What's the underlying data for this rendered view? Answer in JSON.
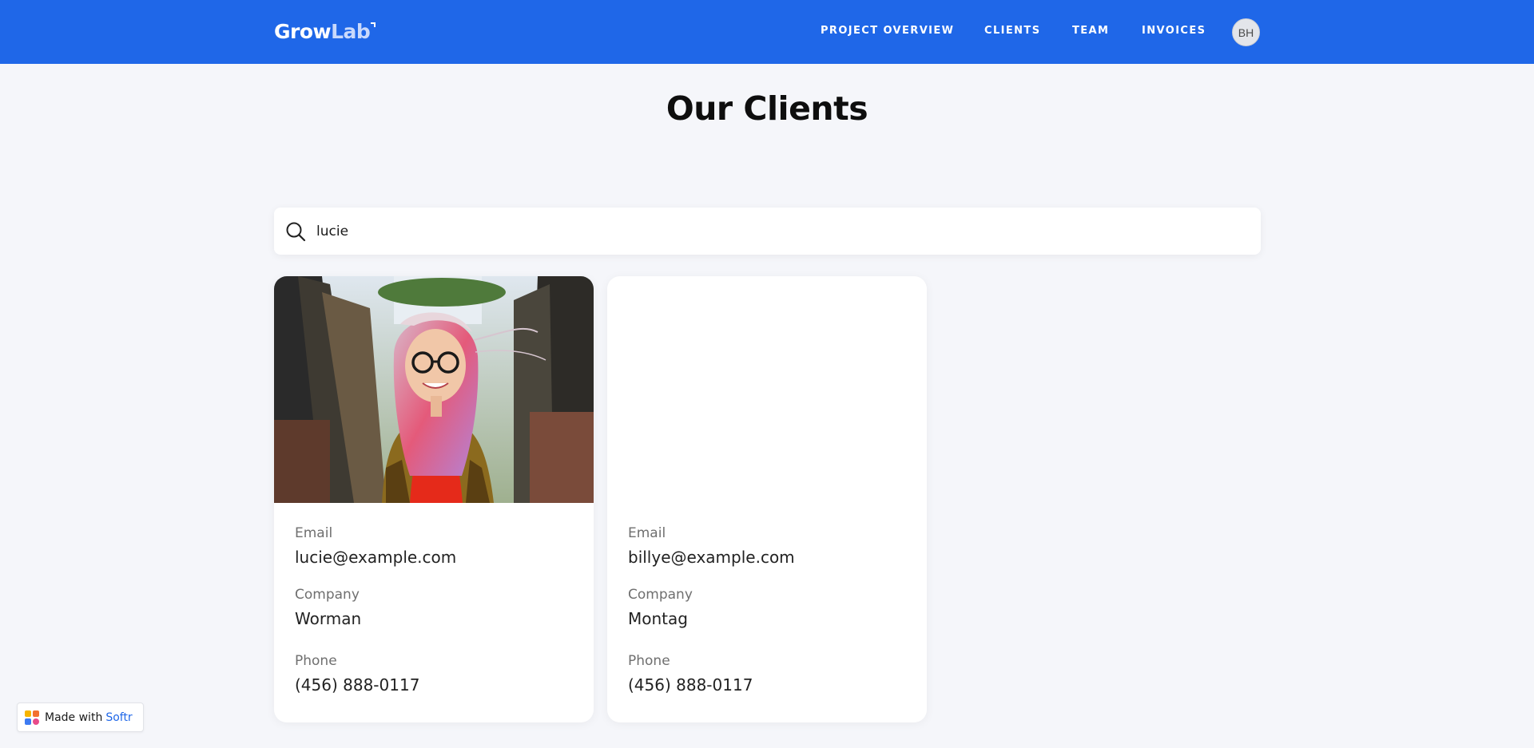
{
  "header": {
    "logo_part1": "Grow",
    "logo_part2": "Lab",
    "nav": [
      {
        "label": "PROJECT OVERVIEW"
      },
      {
        "label": "CLIENTS"
      },
      {
        "label": "TEAM"
      },
      {
        "label": "INVOICES"
      }
    ],
    "avatar_initials": "BH"
  },
  "main": {
    "title": "Our Clients",
    "search": {
      "value": "lucie",
      "icon": "search-icon"
    },
    "clients": [
      {
        "has_photo": true,
        "email_label": "Email",
        "email": "lucie@example.com",
        "company_label": "Company",
        "company": "Worman",
        "phone_label": "Phone",
        "phone": "(456) 888-0117"
      },
      {
        "has_photo": false,
        "email_label": "Email",
        "email": "billye@example.com",
        "company_label": "Company",
        "company": "Montag",
        "phone_label": "Phone",
        "phone": "(456) 888-0117"
      }
    ]
  },
  "badge": {
    "text": "Made with",
    "brand": "Softr"
  },
  "colors": {
    "header_bg": "#1f67e8",
    "page_bg": "#f5f6fa",
    "accent": "#1f67e8"
  }
}
